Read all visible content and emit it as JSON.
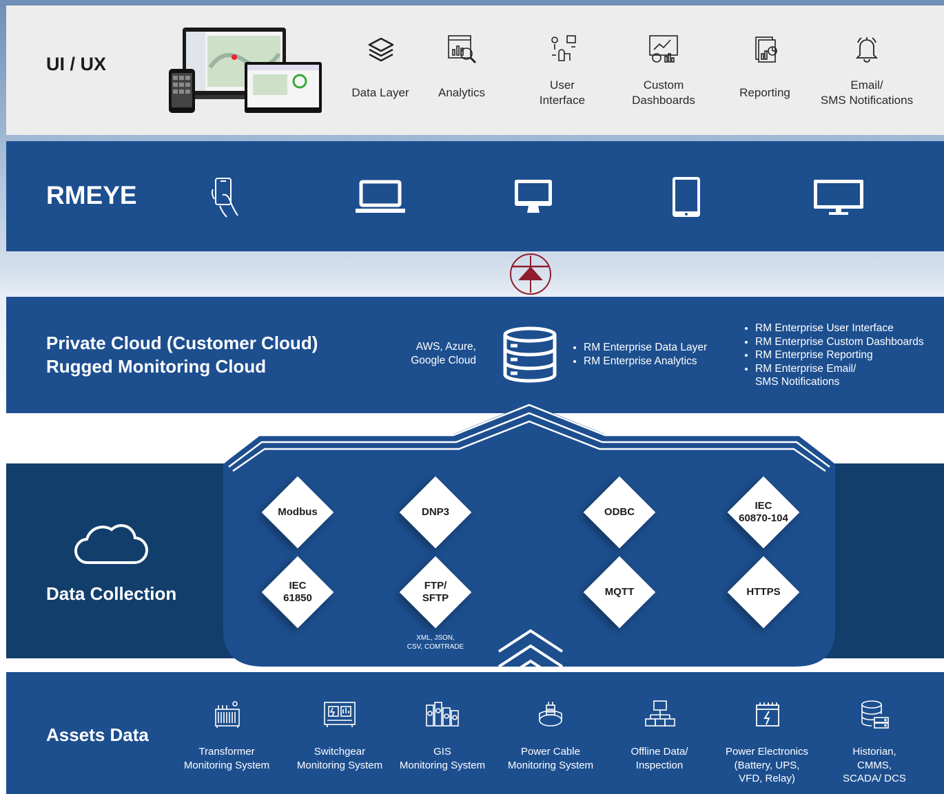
{
  "colors": {
    "band_blue": "#1d4f8f",
    "dark_blue": "#123e6c",
    "hub_blue": "#1d4f8f",
    "arrow_red": "#8f1d2c",
    "uiux_bg": "#ededed"
  },
  "uiux": {
    "title": "UI / UX",
    "features": [
      {
        "icon": "layers-icon",
        "lines": [
          "Data Layer"
        ]
      },
      {
        "icon": "analytics-icon",
        "lines": [
          "Analytics"
        ]
      },
      {
        "icon": "user-interface-icon",
        "lines": [
          "User",
          "Interface"
        ]
      },
      {
        "icon": "dashboard-icon",
        "lines": [
          "Custom",
          "Dashboards"
        ]
      },
      {
        "icon": "report-icon",
        "lines": [
          "Reporting"
        ]
      },
      {
        "icon": "bell-icon",
        "lines": [
          "Email/",
          "SMS Notifications"
        ]
      }
    ]
  },
  "rmeye": {
    "title": "RMEYE",
    "devices": [
      "phone-icon",
      "laptop-icon",
      "desktop-icon",
      "tablet-icon",
      "monitor-icon"
    ]
  },
  "cloud": {
    "title_lines": [
      "Private Cloud (Customer Cloud)",
      "Rugged Monitoring Cloud"
    ],
    "providers": [
      "AWS, Azure,",
      "Google Cloud"
    ],
    "list_a": [
      "RM Enterprise Data Layer",
      "RM Enterprise Analytics"
    ],
    "list_b": [
      "RM Enterprise User Interface",
      "RM Enterprise Custom Dashboards",
      "RM Enterprise Reporting",
      "RM Enterprise Email/\nSMS Notifications"
    ]
  },
  "data_collection": {
    "title": "Data Collection",
    "protocols": [
      {
        "lines": [
          "Modbus"
        ]
      },
      {
        "lines": [
          "DNP3"
        ]
      },
      {
        "lines": [
          "ODBC"
        ]
      },
      {
        "lines": [
          "IEC",
          "60870-104"
        ]
      },
      {
        "lines": [
          "IEC",
          "61850"
        ]
      },
      {
        "lines": [
          "FTP/",
          "SFTP"
        ]
      },
      {
        "lines": [
          "MQTT"
        ]
      },
      {
        "lines": [
          "HTTPS"
        ]
      }
    ],
    "ftp_note": [
      "XML, JSON,",
      "CSV, COMTRADE"
    ]
  },
  "assets": {
    "title": "Assets Data",
    "items": [
      {
        "icon": "transformer-icon",
        "lines": [
          "Transformer",
          "Monitoring System"
        ]
      },
      {
        "icon": "switchgear-icon",
        "lines": [
          "Switchgear",
          "Monitoring System"
        ]
      },
      {
        "icon": "gis-icon",
        "lines": [
          "GIS",
          "Monitoring System"
        ]
      },
      {
        "icon": "power-cable-icon",
        "lines": [
          "Power Cable",
          "Monitoring System"
        ]
      },
      {
        "icon": "network-icon",
        "lines": [
          "Offline Data/",
          "Inspection"
        ]
      },
      {
        "icon": "battery-icon",
        "lines": [
          "Power Electronics",
          "(Battery, UPS,",
          "VFD, Relay)"
        ]
      },
      {
        "icon": "database-icon",
        "lines": [
          "Historian,",
          "CMMS,",
          "SCADA/ DCS"
        ]
      }
    ]
  }
}
